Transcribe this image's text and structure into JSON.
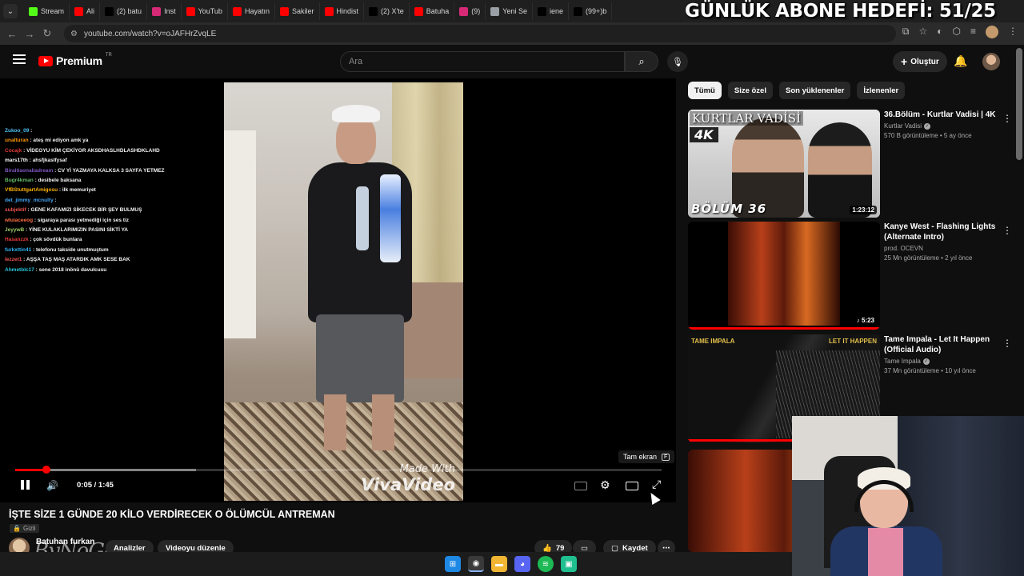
{
  "overlay": {
    "goal_text": "GÜNLÜK ABONE HEDEFİ: 51/25"
  },
  "browser": {
    "tabs": [
      {
        "label": "Stream",
        "color": "#53fc18"
      },
      {
        "label": "Ali",
        "color": "#ff0000"
      },
      {
        "label": "(2) batu",
        "color": "#000000"
      },
      {
        "label": "Inst",
        "color": "#d62976"
      },
      {
        "label": "YouTub",
        "color": "#ff0000"
      },
      {
        "label": "Hayatın",
        "color": "#ff0000"
      },
      {
        "label": "Sakiler",
        "color": "#ff0000"
      },
      {
        "label": "Hindist",
        "color": "#ff0000"
      },
      {
        "label": "(2) X'te",
        "color": "#000000"
      },
      {
        "label": "Batuha",
        "color": "#ff0000"
      },
      {
        "label": "(9)",
        "color": "#d62976"
      },
      {
        "label": "Yeni Se",
        "color": "#9aa0a6"
      },
      {
        "label": "iene",
        "color": "#010101"
      },
      {
        "label": "(99+)b",
        "color": "#010101"
      }
    ],
    "url": "youtube.com/watch?v=oJAFHrZvqLE"
  },
  "youtube": {
    "logo_word": "Premium",
    "logo_country": "TR",
    "search_placeholder": "Ara",
    "create_label": "Oluştur"
  },
  "chat": [
    {
      "user": "Zukoo_09",
      "msg": ":",
      "color": "#4fc3f7"
    },
    {
      "user": "unalturan",
      "msg": ": ateş mi ediyon amk ya",
      "color": "#ff9800"
    },
    {
      "user": "Cocajk",
      "msg": ": VİDEOYU KİM ÇEKİYOR AKSDHASLHDLASHDKLAHD",
      "color": "#e53935"
    },
    {
      "user": "mars17th",
      "msg": ": ahsfjkaslfysaf",
      "color": "#ffffff"
    },
    {
      "user": "Biraltiaonaliadream",
      "msg": ": CV Yİ YAZMAYA KALKSA 3 SAYFA YETMEZ",
      "color": "#7e57c2"
    },
    {
      "user": "Bugr4kman",
      "msg": ": desibele baksana",
      "color": "#66bb6a"
    },
    {
      "user": "VfBStuttgartAmigosu",
      "msg": ": ilk memuriyet",
      "color": "#ffb300"
    },
    {
      "user": "det_jimmy_mcnulty",
      "msg": ":",
      "color": "#42a5f5"
    },
    {
      "user": "subjektif",
      "msg": ": GENE KAFAMIZI SİKECEK BİR ŞEY BULMUŞ",
      "color": "#ef5350"
    },
    {
      "user": "wluiaceeog",
      "msg": ": sigaraya parası yetmediği için ses tiz",
      "color": "#ff7043"
    },
    {
      "user": "JeyywB",
      "msg": ": YİNE KULAKLARIMIZIN PASINI SİKTİ YA",
      "color": "#9ccc65"
    },
    {
      "user": "Hasanzzk",
      "msg": ": çok sövdük bunlara",
      "color": "#e53935"
    },
    {
      "user": "furkxttin41",
      "msg": ": telefonu takside unutmuştum",
      "color": "#29b6f6"
    },
    {
      "user": "lezzet1",
      "msg": ": AŞŞA TAŞ MAŞ ATARDIK AMK SESE BAK",
      "color": "#ef5350"
    },
    {
      "user": "Ahmetblc17",
      "msg": ": sene 2018 inönü davulcusu",
      "color": "#26c6da"
    }
  ],
  "player": {
    "watermark_small": "Made With",
    "watermark_big": "VivaVideo",
    "tooltip_label": "Tam ekran",
    "tooltip_key": "F",
    "current_time": "0:05",
    "duration": "1:45",
    "time_display": "0:05 / 1:45",
    "progress_fraction": 0.048,
    "buffer_fraction": 0.28
  },
  "video": {
    "title": "İŞTE SİZE 1 GÜNDE 20 KİLO VERDİRECEK O ÖLÜMCÜL ANTREMAN",
    "privacy": "Gizli",
    "channel_name": "Batuhan furkan",
    "overlay_logo": "ByNoGame",
    "analytics_label": "Analizler",
    "edit_label": "Videoyu düzenle",
    "likes": "79",
    "save_label": "Kaydet"
  },
  "sidebar": {
    "chips": [
      "Tümü",
      "Size özel",
      "Son yüklenenler",
      "İzlenenler"
    ],
    "active_chip": "Tümü",
    "recommendations": [
      {
        "title": "36.Bölüm - Kurtlar Vadisi | 4K",
        "channel": "Kurtlar Vadisi",
        "verified": true,
        "meta": "570 B görüntüleme • 5 ay önce",
        "duration": "1:23:12",
        "thumb_logo": "KURTLAR VADİSİ",
        "thumb_badge": "4K",
        "thumb_caption": "BÖLÜM 36"
      },
      {
        "title": "Kanye West - Flashing Lights (Alternate Intro)",
        "channel": "prod. OCEVN",
        "verified": false,
        "meta": "25 Mn görüntüleme • 2 yıl önce",
        "duration": "♪ 5:23"
      },
      {
        "title": "Tame Impala - Let It Happen (Official Audio)",
        "channel": "Tame Impala",
        "verified": true,
        "meta": "37 Mn görüntüleme • 10 yıl önce",
        "thumb_left": "TAME IMPALA",
        "thumb_right": "LET IT HAPPEN"
      }
    ]
  }
}
